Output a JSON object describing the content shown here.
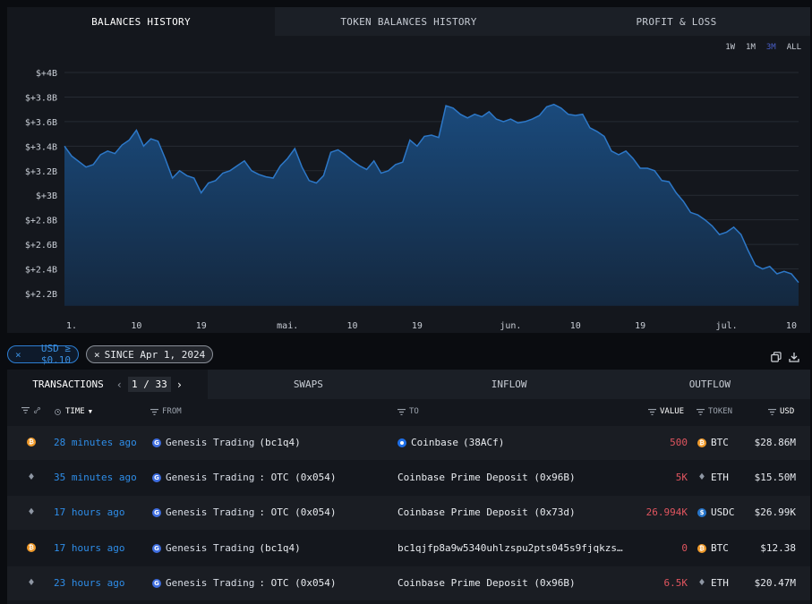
{
  "tabs": [
    {
      "label": "BALANCES HISTORY",
      "active": true
    },
    {
      "label": "TOKEN BALANCES HISTORY",
      "active": false
    },
    {
      "label": "PROFIT & LOSS",
      "active": false
    }
  ],
  "ranges": [
    {
      "label": "1W",
      "active": false
    },
    {
      "label": "1M",
      "active": false
    },
    {
      "label": "3M",
      "active": true
    },
    {
      "label": "ALL",
      "active": false
    }
  ],
  "colors": {
    "area_fill": "#153a62",
    "area_line": "#2d78c8",
    "grid": "#262b33"
  },
  "chart_data": {
    "type": "area",
    "title": "",
    "xlabel": "",
    "ylabel": "",
    "y_tick_labels": [
      "$+4B",
      "$+3.8B",
      "$+3.6B",
      "$+3.4B",
      "$+3.2B",
      "$+3B",
      "$+2.8B",
      "$+2.6B",
      "$+2.4B",
      "$+2.2B"
    ],
    "y_ticks": [
      4.0,
      3.8,
      3.6,
      3.4,
      3.2,
      3.0,
      2.8,
      2.6,
      2.4,
      2.2
    ],
    "ylim": [
      2.1,
      4.1
    ],
    "x_tick_labels": [
      "1.",
      "10",
      "19",
      "mai.",
      "10",
      "19",
      "jun.",
      "10",
      "19",
      "jul.",
      "10"
    ],
    "x_tick_dates": [
      "2024-04-01",
      "2024-04-10",
      "2024-04-19",
      "2024-05-01",
      "2024-05-10",
      "2024-05-19",
      "2024-06-01",
      "2024-06-10",
      "2024-06-19",
      "2024-07-01",
      "2024-07-10"
    ],
    "xlim": [
      "2024-03-31",
      "2024-07-11"
    ],
    "grid": true,
    "series": [
      {
        "dates": [
          "2024-03-31",
          "2024-04-01",
          "2024-04-03",
          "2024-04-04",
          "2024-04-05",
          "2024-04-06",
          "2024-04-07",
          "2024-04-08",
          "2024-04-09",
          "2024-04-10",
          "2024-04-11",
          "2024-04-12",
          "2024-04-13",
          "2024-04-14",
          "2024-04-15",
          "2024-04-16",
          "2024-04-17",
          "2024-04-18",
          "2024-04-19",
          "2024-04-20",
          "2024-04-21",
          "2024-04-22",
          "2024-04-23",
          "2024-04-24",
          "2024-04-25",
          "2024-04-26",
          "2024-04-27",
          "2024-04-28",
          "2024-04-29",
          "2024-04-30",
          "2024-05-01",
          "2024-05-02",
          "2024-05-03",
          "2024-05-04",
          "2024-05-05",
          "2024-05-06",
          "2024-05-07",
          "2024-05-08",
          "2024-05-09",
          "2024-05-10",
          "2024-05-11",
          "2024-05-12",
          "2024-05-13",
          "2024-05-14",
          "2024-05-15",
          "2024-05-16",
          "2024-05-17",
          "2024-05-18",
          "2024-05-19",
          "2024-05-20",
          "2024-05-21",
          "2024-05-22",
          "2024-05-23",
          "2024-05-24",
          "2024-05-25",
          "2024-05-26",
          "2024-05-27",
          "2024-05-28",
          "2024-05-29",
          "2024-05-30",
          "2024-05-31",
          "2024-06-01",
          "2024-06-02",
          "2024-06-03",
          "2024-06-04",
          "2024-06-05",
          "2024-06-06",
          "2024-06-07",
          "2024-06-08",
          "2024-06-09",
          "2024-06-10",
          "2024-06-11",
          "2024-06-12",
          "2024-06-13",
          "2024-06-14",
          "2024-06-15",
          "2024-06-16",
          "2024-06-17",
          "2024-06-18",
          "2024-06-19",
          "2024-06-20",
          "2024-06-21",
          "2024-06-22",
          "2024-06-23",
          "2024-06-24",
          "2024-06-25",
          "2024-06-26",
          "2024-06-27",
          "2024-06-28",
          "2024-06-29",
          "2024-06-30",
          "2024-07-01",
          "2024-07-02",
          "2024-07-03",
          "2024-07-04",
          "2024-07-05",
          "2024-07-06",
          "2024-07-07",
          "2024-07-08",
          "2024-07-09",
          "2024-07-10",
          "2024-07-11"
        ],
        "values": [
          3.4,
          3.32,
          3.23,
          3.25,
          3.33,
          3.36,
          3.34,
          3.41,
          3.45,
          3.53,
          3.4,
          3.46,
          3.44,
          3.3,
          3.14,
          3.2,
          3.16,
          3.14,
          3.02,
          3.1,
          3.12,
          3.18,
          3.2,
          3.24,
          3.28,
          3.2,
          3.17,
          3.15,
          3.14,
          3.24,
          3.3,
          3.38,
          3.23,
          3.12,
          3.1,
          3.16,
          3.35,
          3.37,
          3.33,
          3.28,
          3.24,
          3.21,
          3.28,
          3.18,
          3.2,
          3.25,
          3.27,
          3.45,
          3.4,
          3.48,
          3.49,
          3.47,
          3.73,
          3.71,
          3.66,
          3.63,
          3.66,
          3.64,
          3.68,
          3.62,
          3.6,
          3.62,
          3.59,
          3.6,
          3.62,
          3.65,
          3.72,
          3.74,
          3.71,
          3.66,
          3.65,
          3.66,
          3.55,
          3.52,
          3.48,
          3.36,
          3.33,
          3.36,
          3.3,
          3.22,
          3.22,
          3.2,
          3.12,
          3.11,
          3.02,
          2.95,
          2.86,
          2.84,
          2.8,
          2.75,
          2.68,
          2.7,
          2.74,
          2.68,
          2.55,
          2.43,
          2.4,
          2.42,
          2.36,
          2.38,
          2.36,
          2.29
        ]
      }
    ]
  },
  "filters": {
    "usd": "USD ≥ $0.10",
    "since": "SINCE Apr 1, 2024"
  },
  "icons": {
    "copy": "copy-icon",
    "download": "download-icon"
  },
  "tx_tabs": [
    {
      "label": "TRANSACTIONS"
    },
    {
      "label": "SWAPS"
    },
    {
      "label": "INFLOW"
    },
    {
      "label": "OUTFLOW"
    }
  ],
  "pager": {
    "page": "1",
    "total": "33",
    "slash": "/"
  },
  "headers": {
    "time": "TIME",
    "from": "FROM",
    "to": "TO",
    "value": "VALUE",
    "token": "TOKEN",
    "usd": "USD"
  },
  "rows": [
    {
      "token_icon": "btc",
      "time": "28 minutes ago",
      "from_name": "Genesis Trading",
      "from_detail": "(bc1q4)",
      "to_icon": "coinbase",
      "to_name": "Coinbase",
      "to_detail": "(38ACf)",
      "value": "500",
      "token": "BTC",
      "usd": "$28.86M"
    },
    {
      "token_icon": "eth",
      "time": "35 minutes ago",
      "from_name": "Genesis Trading",
      "from_detail": ": OTC (0x054)",
      "to_icon": "",
      "to_name": "Coinbase Prime Deposit (0x96B)",
      "to_detail": "",
      "value": "5K",
      "token": "ETH",
      "usd": "$15.50M"
    },
    {
      "token_icon": "eth",
      "time": "17 hours ago",
      "from_name": "Genesis Trading",
      "from_detail": ": OTC (0x054)",
      "to_icon": "",
      "to_name": "Coinbase Prime Deposit (0x73d)",
      "to_detail": "",
      "value": "26.994K",
      "token": "USDC",
      "usd": "$26.99K"
    },
    {
      "token_icon": "btc",
      "time": "17 hours ago",
      "from_name": "Genesis Trading",
      "from_detail": "(bc1q4)",
      "to_icon": "",
      "to_name": "bc1qjfp8a9w5340uhlzspu2pts045s9fjqkzs…",
      "to_detail": "",
      "value": "0",
      "token": "BTC",
      "usd": "$12.38"
    },
    {
      "token_icon": "eth",
      "time": "23 hours ago",
      "from_name": "Genesis Trading",
      "from_detail": ": OTC (0x054)",
      "to_icon": "",
      "to_name": "Coinbase Prime Deposit (0x96B)",
      "to_detail": "",
      "value": "6.5K",
      "token": "ETH",
      "usd": "$20.47M"
    }
  ]
}
